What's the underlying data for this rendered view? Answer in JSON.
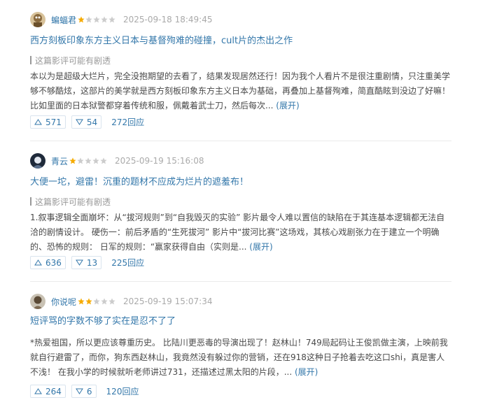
{
  "reviews": [
    {
      "user": "蝙蝠君",
      "rating": 1,
      "time": "2025-09-18 18:49:45",
      "title": "西方刻板印象东方主义日本与基督殉难的碰撞，cult片的杰出之作",
      "spoiler": "这篇影评可能有剧透",
      "body": "本以为是超级大烂片，完全没抱期望的去看了，结果发现居然还行！因为我个人看片不是很注重剧情，只注重美学够不够酷炫，这部片的美学就是西方刻板印象东方主义日本为基础，再叠加上基督殉难，简直酷眩到没边了好嘛！ 比如里面的日本狱警都穿着传统和服，佩戴着武士刀，然后每次... ",
      "expand": "(展开)",
      "up": "571",
      "down": "54",
      "replies": "272回应"
    },
    {
      "user": "青云",
      "rating": 1,
      "time": "2025-09-19 15:16:08",
      "title": "大便一坨，避雷！沉重的题材不应成为烂片的遮羞布！",
      "spoiler": "这篇影评可能有剧透",
      "body": "1.叙事逻辑全面崩坏：从“拔河规则”到“自我毁灭的实验” 影片最令人难以置信的缺陷在于其连基本逻辑都无法自洽的剧情设计。 硬伤一：前后矛盾的“生死拔河” 影片中“拔河比赛”这场戏，其核心戏剧张力在于建立一个明确的、恐怖的规则： 日军的规则：“赢家获得自由（实则是... ",
      "expand": "(展开)",
      "up": "636",
      "down": "13",
      "replies": "225回应"
    },
    {
      "user": "你说呢",
      "rating": 2,
      "time": "2025-09-19 15:07:34",
      "title": "短评骂的字数不够了实在是忍不了了",
      "spoiler": "",
      "body": "*热爱祖国，所以更应该尊重历史。 比陆川更恶毒的导演出现了！赵林山！749局起码让王俊凯做主演，上映前我就自行避雷了，而你，狗东西赵林山，我竟然没有躲过你的营销，还在918这种日子抢着去吃这口shi，真是害人不浅！ 在我小学的时候就听老师讲过731，还描述过黑太阳的片段，... ",
      "expand": "(展开)",
      "up": "264",
      "down": "6",
      "replies": "120回应"
    }
  ],
  "colors": {
    "link": "#3377aa",
    "star": "#f6ab00",
    "star_empty": "#cccccc",
    "meta": "#aaaaaa"
  },
  "icons": {
    "upvote": "triangle-up-icon",
    "downvote": "triangle-down-icon",
    "star": "star-icon"
  }
}
